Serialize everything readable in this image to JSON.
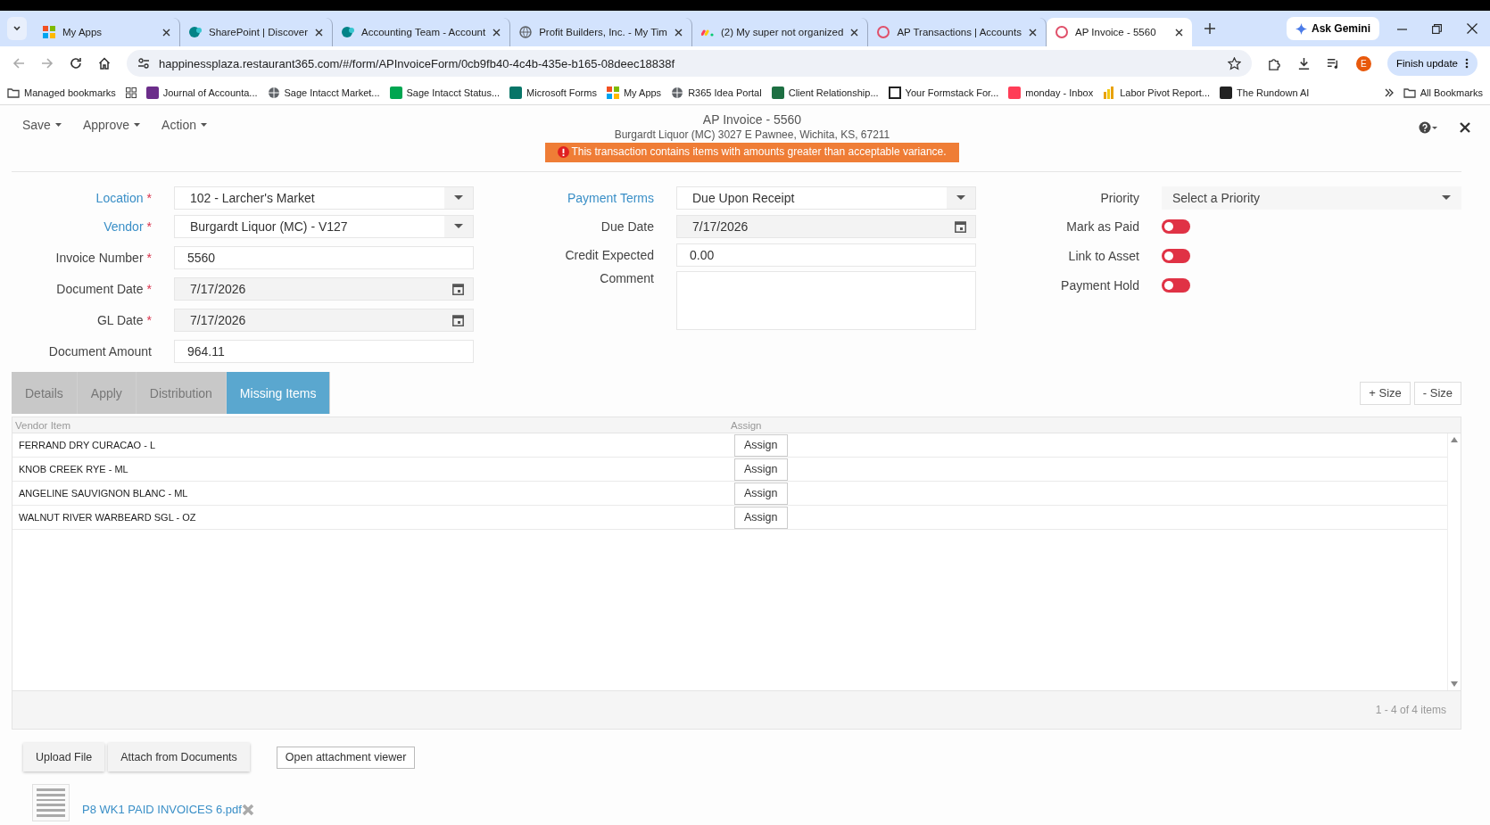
{
  "browser": {
    "tabs": [
      {
        "title": "My Apps",
        "kind": "apps",
        "selected": false
      },
      {
        "title": "SharePoint | Discover",
        "kind": "sharepoint",
        "selected": false
      },
      {
        "title": "Accounting Team - Account",
        "kind": "sharepoint",
        "selected": false
      },
      {
        "title": "Profit Builders, Inc. - My Tim",
        "kind": "globe",
        "selected": false
      },
      {
        "title": "(2) My super not organized",
        "kind": "monday",
        "selected": false
      },
      {
        "title": "AP Transactions | Accounts",
        "kind": "r365",
        "selected": false
      },
      {
        "title": "AP Invoice - 5560",
        "kind": "r365",
        "selected": true
      }
    ],
    "gemini": "Ask Gemini",
    "url": "happinessplaza.restaurant365.com/#/form/APInvoiceForm/0cb9fb40-4c4b-435e-b165-08deec18838f",
    "profile": "E",
    "update": "Finish update",
    "bookmarks": [
      {
        "label": "Managed bookmarks",
        "kind": "folder"
      },
      {
        "label": "Journal of Accounta...",
        "kind": "journal"
      },
      {
        "label": "Sage Intacct Market...",
        "kind": "globe"
      },
      {
        "label": "Sage Intacct Status...",
        "kind": "sage"
      },
      {
        "label": "Microsoft Forms",
        "kind": "forms"
      },
      {
        "label": "My Apps",
        "kind": "apps"
      },
      {
        "label": "R365 Idea Portal",
        "kind": "globe"
      },
      {
        "label": "Client Relationship...",
        "kind": "excel"
      },
      {
        "label": "Your Formstack For...",
        "kind": "page"
      },
      {
        "label": "monday - Inbox",
        "kind": "monday"
      },
      {
        "label": "Labor Pivot Report...",
        "kind": "chart"
      },
      {
        "label": "The Rundown AI",
        "kind": "rundown"
      }
    ],
    "all_bookmarks": "All Bookmarks"
  },
  "form": {
    "menus": [
      "Save",
      "Approve",
      "Action"
    ],
    "title": "AP Invoice - 5560",
    "subtitle": "Burgardt Liquor (MC) 3027 E Pawnee, Wichita, KS, 67211",
    "warning": "This transaction contains items with amounts greater than acceptable variance.",
    "left_fields": [
      {
        "label": "Location",
        "mark": "*",
        "link": true,
        "kind": "select",
        "value": "102 - Larcher's Market"
      },
      {
        "label": "Vendor",
        "mark": "*",
        "link": true,
        "kind": "select",
        "value": "Burgardt Liquor (MC) - V127"
      },
      {
        "label": "Invoice Number",
        "mark": "*",
        "link": false,
        "kind": "text",
        "value": "5560"
      },
      {
        "label": "Document Date",
        "mark": "*",
        "link": false,
        "kind": "date",
        "value": "7/17/2026"
      },
      {
        "label": "GL Date",
        "mark": "*",
        "link": false,
        "kind": "date",
        "value": "7/17/2026"
      },
      {
        "label": "Document Amount",
        "link": false,
        "kind": "text",
        "value": "964.11"
      }
    ],
    "middle_fields": [
      {
        "label": "Payment Terms",
        "link": true,
        "kind": "select",
        "value": "Due Upon Receipt"
      },
      {
        "label": "Due Date",
        "link": false,
        "kind": "date",
        "value": "7/17/2026"
      },
      {
        "label": "Credit Expected",
        "link": false,
        "kind": "text",
        "value": "0.00"
      },
      {
        "label": "Comment",
        "link": false,
        "kind": "textarea"
      }
    ],
    "priority": {
      "label": "Priority",
      "placeholder": "Select a Priority"
    },
    "toggles": [
      {
        "label": "Mark as Paid",
        "on": false
      },
      {
        "label": "Link to Asset",
        "on": false
      },
      {
        "label": "Payment Hold",
        "on": false
      }
    ]
  },
  "tabs": [
    {
      "label": "Details",
      "selected": false
    },
    {
      "label": "Apply",
      "selected": false
    },
    {
      "label": "Distribution",
      "selected": false
    },
    {
      "label": "Missing Items",
      "selected": true
    }
  ],
  "size_buttons": [
    "+ Size",
    "- Size"
  ],
  "grid": {
    "columns": [
      "Vendor Item",
      "Assign"
    ],
    "rows": [
      {
        "item": "FERRAND DRY CURACAO - L",
        "action": "Assign"
      },
      {
        "item": "KNOB CREEK RYE - ML",
        "action": "Assign"
      },
      {
        "item": "ANGELINE SAUVIGNON BLANC - ML",
        "action": "Assign"
      },
      {
        "item": "WALNUT RIVER WARBEARD SGL - OZ",
        "action": "Assign"
      }
    ],
    "pager": "1 - 4 of 4 items"
  },
  "attachments": {
    "buttons": [
      "Upload File",
      "Attach from Documents"
    ],
    "viewer": "Open attachment viewer",
    "files": [
      "P8 WK1 PAID INVOICES 6.pdf"
    ]
  }
}
